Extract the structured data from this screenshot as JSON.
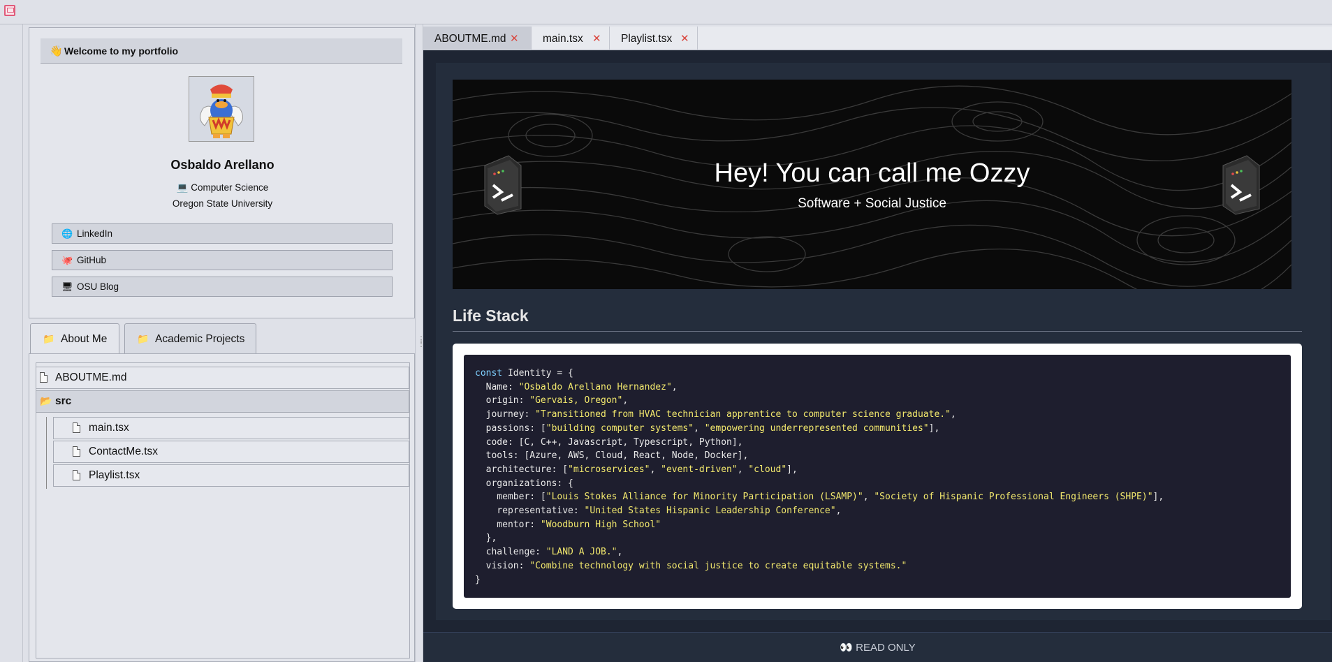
{
  "profile": {
    "header_icon": "waving-hand-icon",
    "header_title": "Welcome to my portfolio",
    "name": "Osbaldo Arellano",
    "degree": "💻 Computer Science",
    "school": "Oregon State University",
    "links": [
      {
        "label": "LinkedIn",
        "icon": "globe-icon"
      },
      {
        "label": "GitHub",
        "icon": "octopus-icon"
      },
      {
        "label": "OSU Blog",
        "icon": "monitor-icon"
      }
    ]
  },
  "folder_tabs": [
    {
      "label": "About Me",
      "active": true
    },
    {
      "label": "Academic Projects",
      "active": false
    }
  ],
  "tree": {
    "items": [
      {
        "label": "ABOUTME.md",
        "type": "file"
      },
      {
        "label": "src",
        "type": "folder"
      },
      {
        "label": "main.tsx",
        "type": "file"
      },
      {
        "label": "ContactMe.tsx",
        "type": "file"
      },
      {
        "label": "Playlist.tsx",
        "type": "file"
      }
    ]
  },
  "editor": {
    "tabs": [
      {
        "label": "ABOUTME.md",
        "active": true
      },
      {
        "label": "main.tsx",
        "active": false
      },
      {
        "label": "Playlist.tsx",
        "active": false
      }
    ],
    "close_glyph": "✕",
    "banner": {
      "headline": "Hey! You can call me Ozzy",
      "tagline": "Software + Social Justice"
    },
    "section_title": "Life Stack",
    "code": {
      "lines": [
        [
          [
            "k",
            "const"
          ],
          [
            "t",
            " Identity = {"
          ]
        ],
        [
          [
            "t",
            "  Name: "
          ],
          [
            "s",
            "\"Osbaldo Arellano Hernandez\""
          ],
          [
            "t",
            ","
          ]
        ],
        [
          [
            "t",
            "  origin: "
          ],
          [
            "s",
            "\"Gervais, Oregon\""
          ],
          [
            "t",
            ","
          ]
        ],
        [
          [
            "t",
            "  journey: "
          ],
          [
            "s",
            "\"Transitioned from HVAC technician apprentice to computer science graduate.\""
          ],
          [
            "t",
            ","
          ]
        ],
        [
          [
            "t",
            "  passions: ["
          ],
          [
            "s",
            "\"building computer systems\""
          ],
          [
            "t",
            ", "
          ],
          [
            "s",
            "\"empowering underrepresented communities\""
          ],
          [
            "t",
            "],"
          ]
        ],
        [
          [
            "t",
            "  code: [C, C++, Javascript, Typescript, Python],"
          ]
        ],
        [
          [
            "t",
            "  tools: [Azure, AWS, Cloud, React, Node, Docker],"
          ]
        ],
        [
          [
            "t",
            "  architecture: ["
          ],
          [
            "s",
            "\"microservices\""
          ],
          [
            "t",
            ", "
          ],
          [
            "s",
            "\"event-driven\""
          ],
          [
            "t",
            ", "
          ],
          [
            "s",
            "\"cloud\""
          ],
          [
            "t",
            "],"
          ]
        ],
        [
          [
            "t",
            "  organizations: {"
          ]
        ],
        [
          [
            "t",
            "    member: ["
          ],
          [
            "s",
            "\"Louis Stokes Alliance for Minority Participation (LSAMP)\""
          ],
          [
            "t",
            ", "
          ],
          [
            "s",
            "\"Society of Hispanic Professional Engineers (SHPE)\""
          ],
          [
            "t",
            "],"
          ]
        ],
        [
          [
            "t",
            "    representative: "
          ],
          [
            "s",
            "\"United States Hispanic Leadership Conference\""
          ],
          [
            "t",
            ","
          ]
        ],
        [
          [
            "t",
            "    mentor: "
          ],
          [
            "s",
            "\"Woodburn High School\""
          ]
        ],
        [
          [
            "t",
            "  },"
          ]
        ],
        [
          [
            "t",
            "  challenge: "
          ],
          [
            "s",
            "\"LAND A JOB.\""
          ],
          [
            "t",
            ","
          ]
        ],
        [
          [
            "t",
            "  vision: "
          ],
          [
            "s",
            "\"Combine technology with social justice to create equitable systems.\""
          ]
        ],
        [
          [
            "t",
            "}"
          ]
        ]
      ]
    },
    "footer": "👀 READ ONLY"
  }
}
